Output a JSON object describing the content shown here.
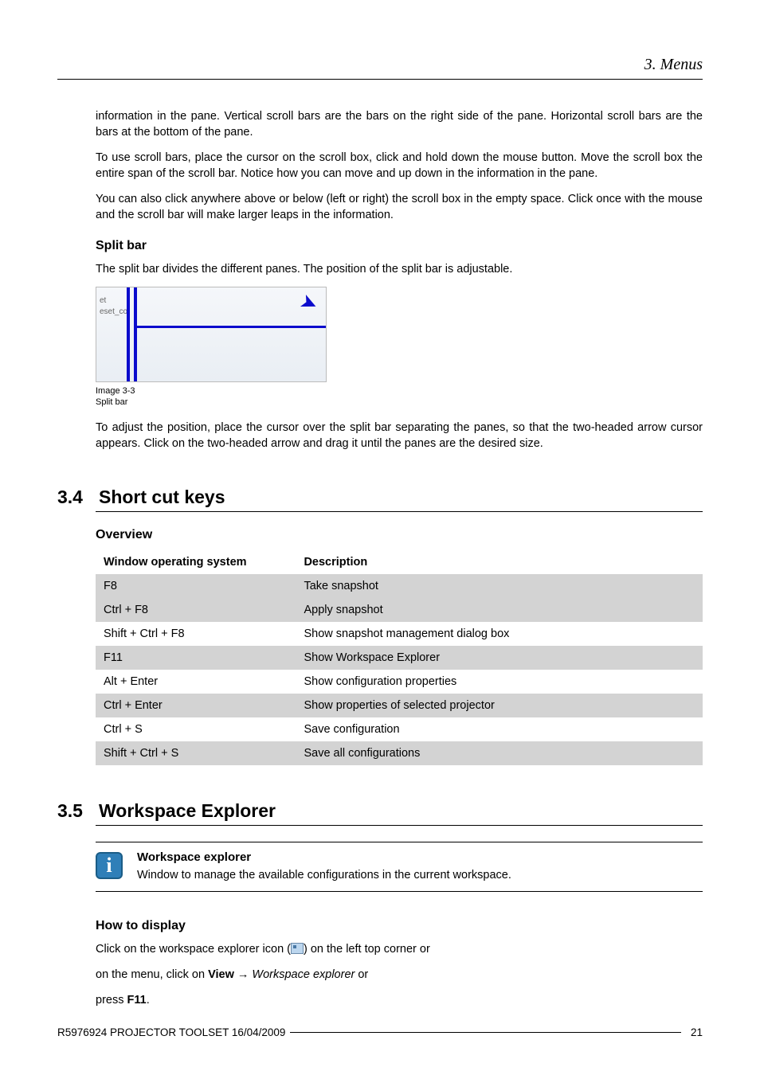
{
  "header": {
    "chapter": "3.  Menus"
  },
  "intro": {
    "p1": "information in the pane.  Vertical scroll bars are the bars on the right side of the pane.  Horizontal scroll bars are the bars at the bottom of the pane.",
    "p2": "To use scroll bars, place the cursor on the scroll box, click and hold down the mouse button.  Move the scroll box the entire span of the scroll bar.  Notice how you can move and up down in the information in the pane.",
    "p3": "You can also click anywhere above or below (left or right) the scroll box in the empty space.  Click once with the mouse and the scroll bar will make larger leaps in the information."
  },
  "splitbar": {
    "heading": "Split bar",
    "p1": "The split bar divides the different panes.  The position of the split bar is adjustable.",
    "caption_l1": "Image 3-3",
    "caption_l2": "Split bar",
    "img_txt": "et\neset_co",
    "p2": "To adjust the position, place the cursor over the split bar separating the panes, so that the two-headed arrow cursor appears.  Click on the two-headed arrow and drag it until the panes are the desired size."
  },
  "sec34": {
    "num": "3.4",
    "title": "Short cut keys",
    "overview": "Overview",
    "th1": "Window operating system",
    "th2": "Description",
    "rows": [
      {
        "k": "F8",
        "d": "Take snapshot"
      },
      {
        "k": "Ctrl + F8",
        "d": "Apply snapshot"
      },
      {
        "k": "Shift + Ctrl + F8",
        "d": "Show snapshot management dialog box"
      },
      {
        "k": "F11",
        "d": "Show Workspace Explorer"
      },
      {
        "k": "Alt + Enter",
        "d": "Show configuration properties"
      },
      {
        "k": "Ctrl + Enter",
        "d": "Show properties of selected projector"
      },
      {
        "k": "Ctrl + S",
        "d": "Save configuration"
      },
      {
        "k": "Shift + Ctrl + S",
        "d": "Save all configurations"
      }
    ]
  },
  "sec35": {
    "num": "3.5",
    "title": "Workspace Explorer",
    "info_title": "Workspace explorer",
    "info_body": "Window to manage the available configurations in the current workspace.",
    "howto_heading": "How to display",
    "line1_a": "Click on the workspace explorer icon (",
    "line1_b": ") on the left top corner or",
    "line2_a": "on the menu, click on ",
    "line2_view": "View",
    "line2_arrow": " → ",
    "line2_item": "Workspace explorer",
    "line2_b": " or",
    "line3_a": "press ",
    "line3_key": "F11",
    "line3_b": "."
  },
  "footer": {
    "left": "R5976924   PROJECTOR TOOLSET   16/04/2009",
    "page": "21"
  }
}
